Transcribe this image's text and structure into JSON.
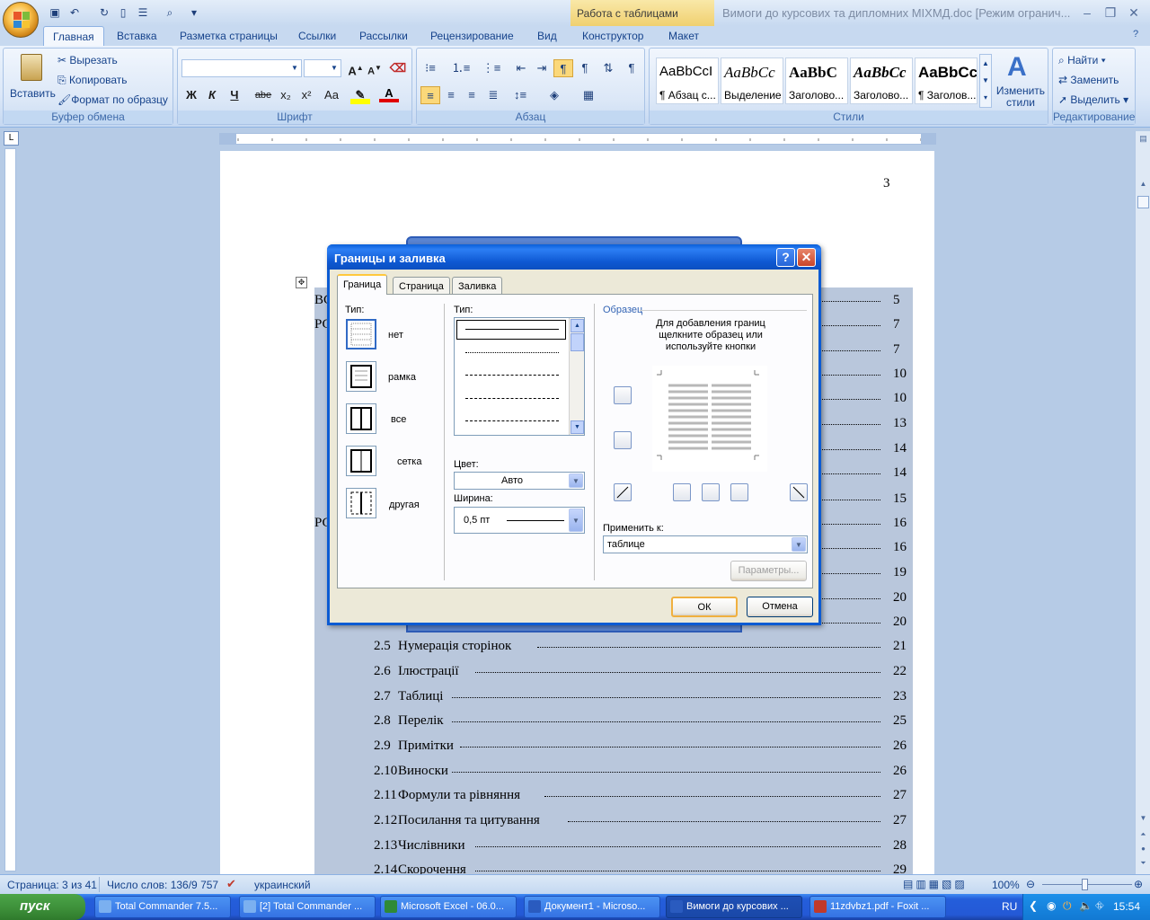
{
  "window": {
    "doc_title": "Вимоги до курсових та дипломних МІХМД.doc [Режим огранич...",
    "context_group": "Работа с таблицами"
  },
  "tabs": [
    "Главная",
    "Вставка",
    "Разметка страницы",
    "Ссылки",
    "Рассылки",
    "Рецензирование",
    "Вид",
    "Конструктор",
    "Макет"
  ],
  "ribbon": {
    "clipboard": {
      "paste": "Вставить",
      "cut": "Вырезать",
      "copy": "Копировать",
      "format_painter": "Формат по образцу",
      "label": "Буфер обмена"
    },
    "font": {
      "label": "Шрифт",
      "bold": "Ж",
      "italic": "К",
      "underline": "Ч",
      "strike": "abe",
      "sub": "x₂",
      "sup": "x²",
      "case": "Aa",
      "grow": "A",
      "shrink": "A"
    },
    "paragraph": {
      "label": "Абзац"
    },
    "styles": {
      "label": "Стили",
      "items": [
        {
          "sample": "AaBbCcI",
          "name": "¶ Абзац с..."
        },
        {
          "sample": "AaBbCc",
          "name": "Выделение"
        },
        {
          "sample": "AaBbC",
          "name": "Заголово..."
        },
        {
          "sample": "AaBbCc",
          "name": "Заголово..."
        },
        {
          "sample": "AaBbCc",
          "name": "¶ Заголов..."
        }
      ],
      "change_styles": "Изменить стили"
    },
    "editing": {
      "find": "Найти",
      "replace": "Заменить",
      "select": "Выделить",
      "label": "Редактирование"
    }
  },
  "page": {
    "page_number": "3",
    "toc": [
      {
        "num": "",
        "text": "ВС",
        "page": "5"
      },
      {
        "num": "",
        "text": "РС",
        "page": "7"
      },
      {
        "num": "",
        "text": "",
        "page": "7"
      },
      {
        "num": "",
        "text": "",
        "page": "10"
      },
      {
        "num": "",
        "text": "",
        "page": "10"
      },
      {
        "num": "",
        "text": "",
        "page": "13"
      },
      {
        "num": "",
        "text": "",
        "page": "14"
      },
      {
        "num": "",
        "text": "",
        "page": "14"
      },
      {
        "num": "",
        "text": "",
        "page": "15"
      },
      {
        "num": "",
        "text": "РС",
        "page": "16"
      },
      {
        "num": "",
        "text": "",
        "page": "16"
      },
      {
        "num": "",
        "text": "",
        "page": "19"
      },
      {
        "num": "",
        "text": "",
        "page": "20"
      },
      {
        "num": "",
        "text": "",
        "page": "20"
      },
      {
        "num": "2.5",
        "text": "Нумерація сторінок",
        "page": "21"
      },
      {
        "num": "2.6",
        "text": "Ілюстрації",
        "page": "22"
      },
      {
        "num": "2.7",
        "text": "Таблиці",
        "page": "23"
      },
      {
        "num": "2.8",
        "text": "Перелік",
        "page": "25"
      },
      {
        "num": "2.9",
        "text": "Примітки",
        "page": "26"
      },
      {
        "num": "2.10",
        "text": "Виноски",
        "page": "26"
      },
      {
        "num": "2.11",
        "text": "Формули та рівняння",
        "page": "27"
      },
      {
        "num": "2.12",
        "text": "Посилання та цитування",
        "page": "27"
      },
      {
        "num": "2.13",
        "text": "Числівники",
        "page": "28"
      },
      {
        "num": "2.14",
        "text": "Скорочення",
        "page": "29"
      }
    ]
  },
  "dialog": {
    "title": "Границы и заливка",
    "tabs": [
      "Граница",
      "Страница",
      "Заливка"
    ],
    "type_label": "Тип:",
    "presets": [
      "нет",
      "рамка",
      "все",
      "сетка",
      "другая"
    ],
    "line_type_label": "Тип:",
    "color_label": "Цвет:",
    "color_value": "Авто",
    "width_label": "Ширина:",
    "width_value": "0,5 пт",
    "sample_label": "Образец",
    "sample_hint": "Для добавления границ щелкните образец или используйте кнопки",
    "apply_label": "Применить к:",
    "apply_value": "таблице",
    "options_button": "Параметры...",
    "ok": "ОК",
    "cancel": "Отмена"
  },
  "statusbar": {
    "page": "Страница: 3 из 41",
    "words": "Число слов: 136/9 757",
    "language": "украинский",
    "zoom": "100%"
  },
  "taskbar": {
    "start": "пуск",
    "items": [
      {
        "label": "Total Commander 7.5...",
        "color": "#7bb0f0"
      },
      {
        "label": "[2] Total Commander ...",
        "color": "#7bb0f0"
      },
      {
        "label": "Microsoft Excel - 06.0...",
        "color": "#2f8a36"
      },
      {
        "label": "Документ1 - Microso...",
        "color": "#2a5bbf"
      },
      {
        "label": "Вимоги до курсових ...",
        "color": "#2a5bbf"
      },
      {
        "label": "11zdvbz1.pdf - Foxit ...",
        "color": "#c0392b"
      }
    ],
    "lang": "RU",
    "clock": "15:54"
  }
}
